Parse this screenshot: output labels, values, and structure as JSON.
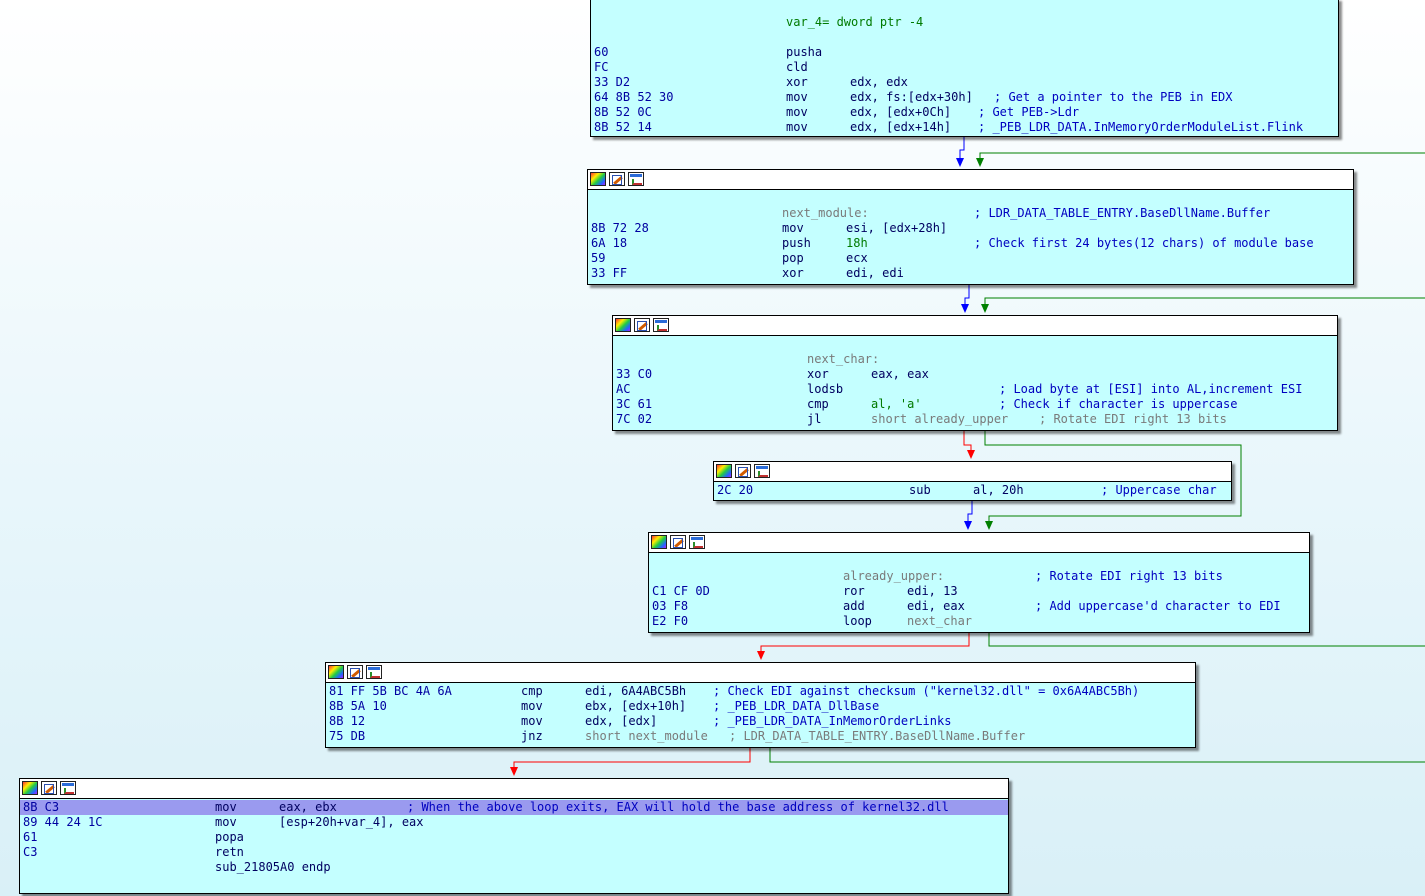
{
  "nodes": [
    {
      "id": "entry",
      "lines": [
        {
          "bytes": "",
          "label": "var_4= dword ptr -4",
          "mnem": "",
          "ops": "",
          "comment": ""
        },
        {
          "bytes": "",
          "label": "",
          "mnem": "",
          "ops": "",
          "comment": ""
        },
        {
          "bytes": "60",
          "label": "",
          "mnem": "pusha",
          "ops": "",
          "comment": ""
        },
        {
          "bytes": "FC",
          "label": "",
          "mnem": "cld",
          "ops": "",
          "comment": ""
        },
        {
          "bytes": "33 D2",
          "label": "",
          "mnem": "xor",
          "ops": "edx, edx",
          "comment": ""
        },
        {
          "bytes": "64 8B 52 30",
          "label": "",
          "mnem": "mov",
          "ops": "edx, fs:[edx+30h]",
          "comment": "; Get a pointer to the PEB in EDX"
        },
        {
          "bytes": "8B 52 0C",
          "label": "",
          "mnem": "mov",
          "ops": "edx, [edx+0Ch]",
          "comment": "; Get PEB->Ldr"
        },
        {
          "bytes": "8B 52 14",
          "label": "",
          "mnem": "mov",
          "ops": "edx, [edx+14h]",
          "comment": "; _PEB_LDR_DATA.InMemoryOrderModuleList.Flink"
        }
      ]
    },
    {
      "id": "next_module",
      "lines": [
        {
          "bytes": "",
          "label": "",
          "mnem": "",
          "ops": "",
          "comment": ""
        },
        {
          "bytes": "",
          "label": "next_module:",
          "mnem": "",
          "ops": "",
          "comment": "; LDR_DATA_TABLE_ENTRY.BaseDllName.Buffer"
        },
        {
          "bytes": "8B 72 28",
          "label": "",
          "mnem": "mov",
          "ops": "esi, [edx+28h]",
          "comment": ""
        },
        {
          "bytes": "6A 18",
          "label": "",
          "mnem": "push",
          "ops": "18h",
          "comment": "; Check first 24 bytes(12 chars) of module base"
        },
        {
          "bytes": "59",
          "label": "",
          "mnem": "pop",
          "ops": "ecx",
          "comment": ""
        },
        {
          "bytes": "33 FF",
          "label": "",
          "mnem": "xor",
          "ops": "edi, edi",
          "comment": ""
        }
      ]
    },
    {
      "id": "next_char",
      "lines": [
        {
          "bytes": "",
          "label": "",
          "mnem": "",
          "ops": "",
          "comment": ""
        },
        {
          "bytes": "",
          "label": "next_char:",
          "mnem": "",
          "ops": "",
          "comment": ""
        },
        {
          "bytes": "33 C0",
          "label": "",
          "mnem": "xor",
          "ops": "eax, eax",
          "comment": ""
        },
        {
          "bytes": "AC",
          "label": "",
          "mnem": "lodsb",
          "ops": "",
          "comment": "; Load byte at [ESI] into AL,increment ESI"
        },
        {
          "bytes": "3C 61",
          "label": "",
          "mnem": "cmp",
          "ops": "al, 'a'",
          "comment": "; Check if character is uppercase"
        },
        {
          "bytes": "7C 02",
          "label": "",
          "mnem": "jl",
          "ops": "short already_upper",
          "comment": "; Rotate EDI right 13 bits"
        }
      ]
    },
    {
      "id": "sub_al",
      "lines": [
        {
          "bytes": "2C 20",
          "label": "",
          "mnem": "sub",
          "ops": "al, 20h",
          "comment": "; Uppercase char"
        }
      ]
    },
    {
      "id": "already_upper",
      "lines": [
        {
          "bytes": "",
          "label": "",
          "mnem": "",
          "ops": "",
          "comment": ""
        },
        {
          "bytes": "",
          "label": "already_upper:",
          "mnem": "",
          "ops": "",
          "comment": "; Rotate EDI right 13 bits"
        },
        {
          "bytes": "C1 CF 0D",
          "label": "",
          "mnem": "ror",
          "ops": "edi, 13",
          "comment": ""
        },
        {
          "bytes": "03 F8",
          "label": "",
          "mnem": "add",
          "ops": "edi, eax",
          "comment": "; Add uppercase'd character to EDI"
        },
        {
          "bytes": "E2 F0",
          "label": "",
          "mnem": "loop",
          "ops": "next_char",
          "comment": ""
        }
      ]
    },
    {
      "id": "checksum",
      "lines": [
        {
          "bytes": "81 FF 5B BC 4A 6A",
          "label": "",
          "mnem": "cmp",
          "ops": "edi, 6A4ABC5Bh",
          "comment": "; Check EDI against checksum (\"kernel32.dll\" = 0x6A4ABC5Bh)"
        },
        {
          "bytes": "8B 5A 10",
          "label": "",
          "mnem": "mov",
          "ops": "ebx, [edx+10h]",
          "comment": "; _PEB_LDR_DATA_DllBase"
        },
        {
          "bytes": "8B 12",
          "label": "",
          "mnem": "mov",
          "ops": "edx, [edx]",
          "comment": "; _PEB_LDR_DATA_InMemorOrderLinks"
        },
        {
          "bytes": "75 DB",
          "label": "",
          "mnem": "jnz",
          "ops": "short next_module",
          "comment": "; LDR_DATA_TABLE_ENTRY.BaseDllName.Buffer"
        }
      ]
    },
    {
      "id": "exit",
      "lines": [
        {
          "bytes": "8B C3",
          "label": "",
          "mnem": "mov",
          "ops": "eax, ebx",
          "comment": "; When the above loop exits, EAX will hold the base address of kernel32.dll"
        },
        {
          "bytes": "89 44 24 1C",
          "label": "",
          "mnem": "mov",
          "ops": "[esp+20h+var_4], eax",
          "comment": ""
        },
        {
          "bytes": "61",
          "label": "",
          "mnem": "popa",
          "ops": "",
          "comment": ""
        },
        {
          "bytes": "C3",
          "label": "",
          "mnem": "retn",
          "ops": "",
          "comment": ""
        },
        {
          "bytes": "",
          "label": "sub_21805A0 endp",
          "mnem": "",
          "ops": "",
          "comment": ""
        }
      ]
    }
  ],
  "colors": {
    "node_bg": "#c4ffff",
    "edge_true": "#008000",
    "edge_false": "#ff0000",
    "edge_uncond": "#0000ff",
    "highlight": "#9a9aef"
  }
}
